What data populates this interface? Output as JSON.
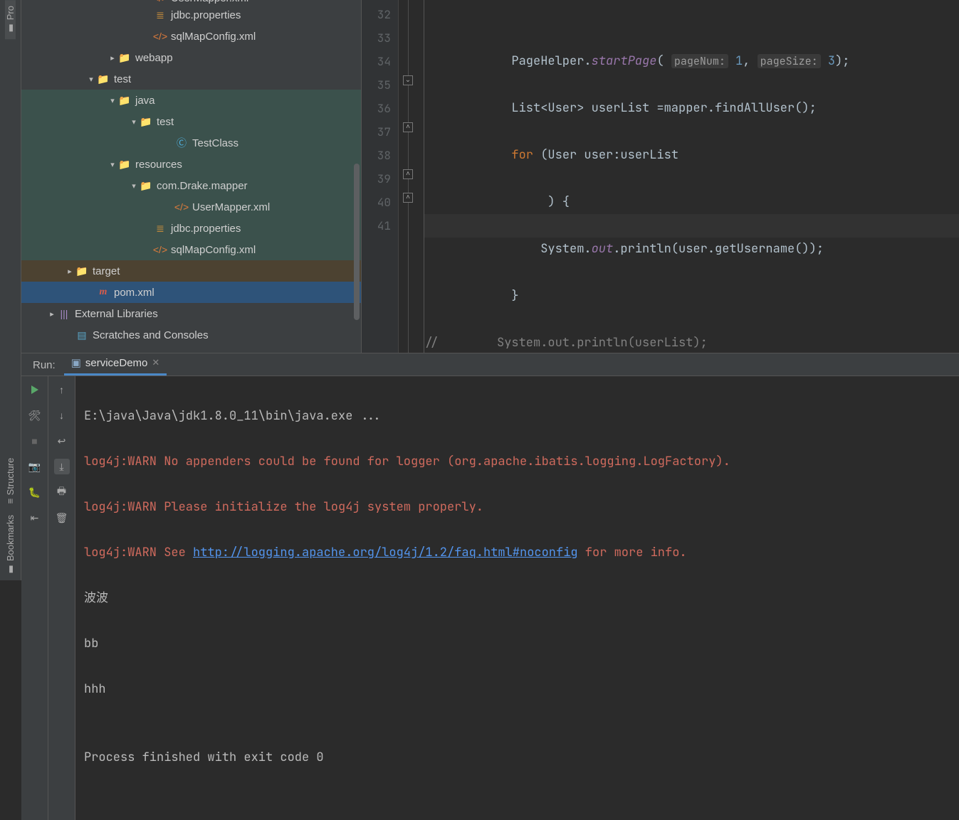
{
  "left_strip": {
    "project": "Pro",
    "structure": "Structure",
    "bookmarks": "Bookmarks"
  },
  "tree": [
    {
      "indent": 170,
      "chev": "",
      "icon": "xml",
      "label": "UserMapper.xml",
      "cls": "",
      "top_crop": true
    },
    {
      "indent": 170,
      "chev": "",
      "icon": "prop",
      "label": "jdbc.properties",
      "cls": ""
    },
    {
      "indent": 170,
      "chev": "",
      "icon": "xml",
      "label": "sqlMapConfig.xml",
      "cls": ""
    },
    {
      "indent": 120,
      "chev": "right",
      "icon": "folder-web",
      "label": "webapp",
      "cls": ""
    },
    {
      "indent": 90,
      "chev": "down",
      "icon": "folder",
      "label": "test",
      "cls": ""
    },
    {
      "indent": 120,
      "chev": "down",
      "icon": "folder-java",
      "label": "java",
      "cls": "highlight-green"
    },
    {
      "indent": 150,
      "chev": "down",
      "icon": "folder",
      "label": "test",
      "cls": "highlight-green"
    },
    {
      "indent": 200,
      "chev": "",
      "icon": "class",
      "label": "TestClass",
      "cls": "highlight-green"
    },
    {
      "indent": 120,
      "chev": "down",
      "icon": "folder-res",
      "label": "resources",
      "cls": "highlight-green"
    },
    {
      "indent": 150,
      "chev": "down",
      "icon": "folder",
      "label": "com.Drake.mapper",
      "cls": "highlight-green"
    },
    {
      "indent": 200,
      "chev": "",
      "icon": "xml",
      "label": "UserMapper.xml",
      "cls": "highlight-green"
    },
    {
      "indent": 170,
      "chev": "",
      "icon": "prop",
      "label": "jdbc.properties",
      "cls": "highlight-green"
    },
    {
      "indent": 170,
      "chev": "",
      "icon": "xml",
      "label": "sqlMapConfig.xml",
      "cls": "highlight-green"
    },
    {
      "indent": 60,
      "chev": "right",
      "icon": "folder-target",
      "label": "target",
      "cls": "sel-orange"
    },
    {
      "indent": 90,
      "chev": "",
      "icon": "maven",
      "label": "pom.xml",
      "cls": "sel-blue"
    },
    {
      "indent": 35,
      "chev": "right",
      "icon": "lib",
      "label": "External Libraries",
      "cls": ""
    },
    {
      "indent": 60,
      "chev": "",
      "icon": "scratch",
      "label": "Scratches and Consoles",
      "cls": ""
    }
  ],
  "editor": {
    "first_line": 32,
    "last_line": 41,
    "caret_line": 41,
    "hints": {
      "pageNum": "pageNum:",
      "pageSize": "pageSize:"
    },
    "code": {
      "l32a": "            PageHelper.",
      "l32b": "startPage",
      "l32c": "( ",
      "l32d": "1",
      "l32e": ", ",
      "l32f": "3",
      "l32g": ");",
      "l33": "            List<User> userList =mapper.findAllUser();",
      "l34a": "            ",
      "l34b": "for",
      "l34c": " (User user:userList",
      "l35": "                 ) {",
      "l36a": "                System.",
      "l36b": "out",
      "l36c": ".println(user.getUsername());",
      "l37": "            }",
      "l38": "//        System.out.println(userList);",
      "l39": "    }",
      "l40": "    }",
      "l41": ""
    }
  },
  "run": {
    "title": "Run:",
    "tab": "serviceDemo",
    "output": {
      "cmd": "E:\\java\\Java\\jdk1.8.0_11\\bin\\java.exe ...",
      "w1": "log4j:WARN No appenders could be found for logger (org.apache.ibatis.logging.LogFactory).",
      "w2": "log4j:WARN Please initialize the log4j system properly.",
      "w3a": "log4j:WARN See ",
      "w3link": "http://logging.apache.org/log4j/1.2/faq.html#noconfig",
      "w3b": " for more info.",
      "o1": "波波",
      "o2": "bb",
      "o3": "hhh",
      "blank": "",
      "exit": "Process finished with exit code 0"
    }
  }
}
